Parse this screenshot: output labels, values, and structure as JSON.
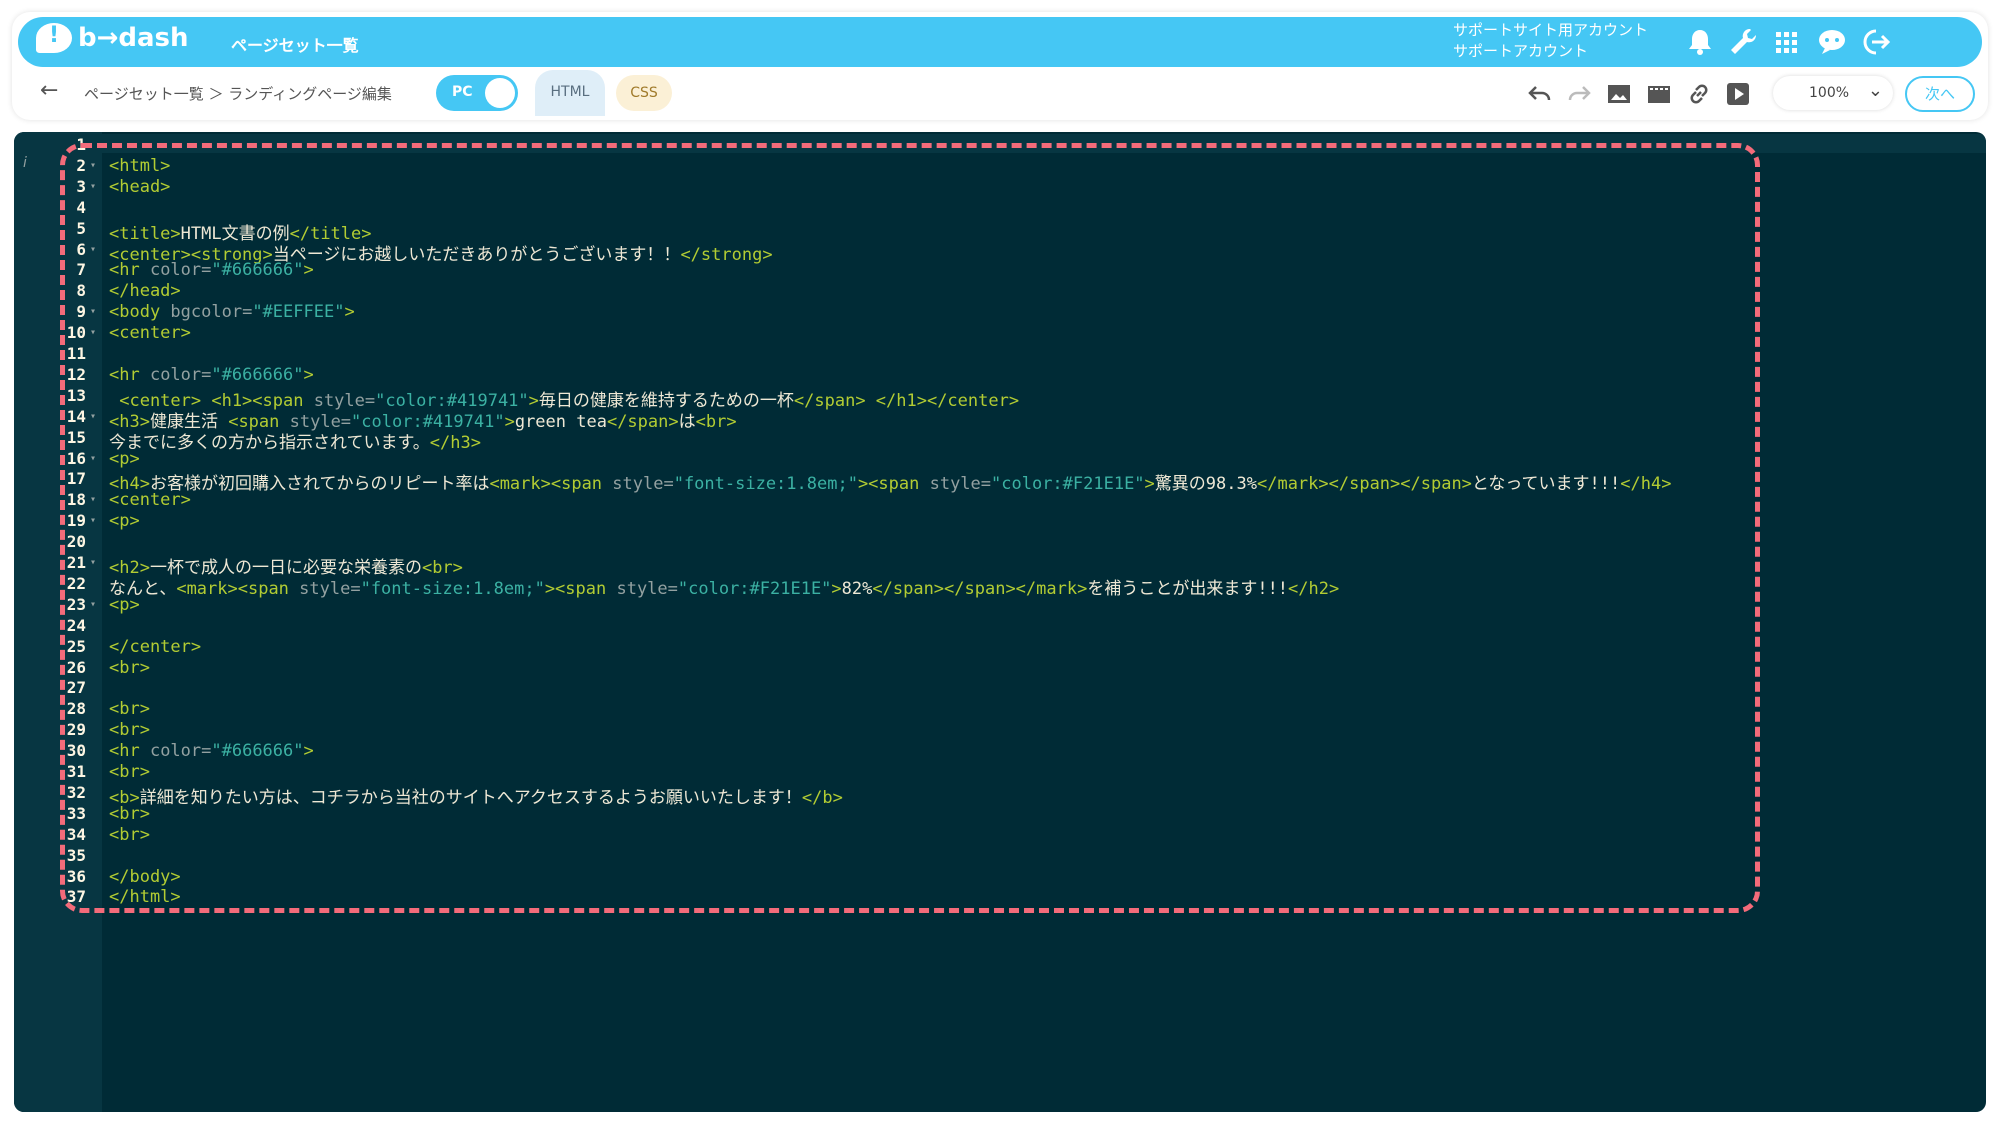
{
  "header": {
    "logo_text": "b→dash",
    "page_title": "ページセット一覧",
    "account_line1": "サポートサイト用アカウント",
    "account_line2": "サポートアカウント",
    "icons": [
      "bell-icon",
      "wrench-icon",
      "grid-icon",
      "chat-icon",
      "logout-icon"
    ]
  },
  "toolbar": {
    "back_icon": "←",
    "breadcrumb": "ページセット一覧 ＞ ランディングページ編集",
    "toggle_label": "PC",
    "tab_html": "HTML",
    "tab_css": "CSS",
    "tools": [
      "undo-icon",
      "redo-icon",
      "image-icon",
      "video-icon",
      "link-icon",
      "play-icon"
    ],
    "zoom": "100%",
    "next_label": "次へ"
  },
  "editor": {
    "info_marker": "i",
    "lines": [
      {
        "n": "1",
        "fold": false,
        "parts": []
      },
      {
        "n": "2",
        "fold": true,
        "parts": [
          [
            "tag",
            "<html>"
          ]
        ]
      },
      {
        "n": "3",
        "fold": true,
        "parts": [
          [
            "tag",
            "<head>"
          ]
        ]
      },
      {
        "n": "4",
        "fold": false,
        "parts": []
      },
      {
        "n": "5",
        "fold": false,
        "parts": [
          [
            "tag",
            "<title>"
          ],
          [
            "txt",
            "HTML文書の例"
          ],
          [
            "tag",
            "</title>"
          ]
        ]
      },
      {
        "n": "6",
        "fold": true,
        "parts": [
          [
            "tag",
            "<center><strong>"
          ],
          [
            "txt",
            "当ページにお越しいただきありがとうございます！！"
          ],
          [
            "tag",
            "</strong>"
          ]
        ]
      },
      {
        "n": "7",
        "fold": false,
        "parts": [
          [
            "tag",
            "<hr "
          ],
          [
            "attr",
            "color="
          ],
          [
            "val",
            "\"#666666\""
          ],
          [
            "tag",
            ">"
          ]
        ]
      },
      {
        "n": "8",
        "fold": false,
        "parts": [
          [
            "tag",
            "</head>"
          ]
        ]
      },
      {
        "n": "9",
        "fold": true,
        "parts": [
          [
            "tag",
            "<body "
          ],
          [
            "attr",
            "bgcolor="
          ],
          [
            "val",
            "\"#EEFFEE\""
          ],
          [
            "tag",
            ">"
          ]
        ]
      },
      {
        "n": "10",
        "fold": true,
        "parts": [
          [
            "tag",
            "<center>"
          ]
        ]
      },
      {
        "n": "11",
        "fold": false,
        "parts": []
      },
      {
        "n": "12",
        "fold": false,
        "parts": [
          [
            "tag",
            "<hr "
          ],
          [
            "attr",
            "color="
          ],
          [
            "val",
            "\"#666666\""
          ],
          [
            "tag",
            ">"
          ]
        ]
      },
      {
        "n": "13",
        "fold": false,
        "parts": [
          [
            "tag",
            " <center> <h1><span "
          ],
          [
            "attr",
            "style="
          ],
          [
            "val",
            "\"color:#419741\""
          ],
          [
            "tag",
            ">"
          ],
          [
            "txt",
            "毎日の健康を維持するための一杯"
          ],
          [
            "tag",
            "</span> </h1></center>"
          ]
        ]
      },
      {
        "n": "14",
        "fold": true,
        "parts": [
          [
            "tag",
            "<h3>"
          ],
          [
            "txt",
            "健康生活 "
          ],
          [
            "tag",
            "<span "
          ],
          [
            "attr",
            "style="
          ],
          [
            "val",
            "\"color:#419741\""
          ],
          [
            "tag",
            ">"
          ],
          [
            "txt",
            "green tea"
          ],
          [
            "tag",
            "</span>"
          ],
          [
            "txt",
            "は"
          ],
          [
            "tag",
            "<br>"
          ]
        ]
      },
      {
        "n": "15",
        "fold": false,
        "parts": [
          [
            "txt",
            "今までに多くの方から指示されています。"
          ],
          [
            "tag",
            "</h3>"
          ]
        ]
      },
      {
        "n": "16",
        "fold": true,
        "parts": [
          [
            "tag",
            "<p>"
          ]
        ]
      },
      {
        "n": "17",
        "fold": false,
        "parts": [
          [
            "tag",
            "<h4>"
          ],
          [
            "txt",
            "お客様が初回購入されてからのリピート率は"
          ],
          [
            "tag",
            "<mark><span "
          ],
          [
            "attr",
            "style="
          ],
          [
            "val",
            "\"font-size:1.8em;\""
          ],
          [
            "tag",
            "><span "
          ],
          [
            "attr",
            "style="
          ],
          [
            "val",
            "\"color:#F21E1E\""
          ],
          [
            "tag",
            ">"
          ],
          [
            "txt",
            "驚異の98.3%"
          ],
          [
            "tag",
            "</mark></span></span>"
          ],
          [
            "txt",
            "となっています!!!"
          ],
          [
            "tag",
            "</h4>"
          ]
        ]
      },
      {
        "n": "18",
        "fold": true,
        "parts": [
          [
            "tag",
            "<center>"
          ]
        ]
      },
      {
        "n": "19",
        "fold": true,
        "parts": [
          [
            "tag",
            "<p>"
          ]
        ]
      },
      {
        "n": "20",
        "fold": false,
        "parts": []
      },
      {
        "n": "21",
        "fold": true,
        "parts": [
          [
            "tag",
            "<h2>"
          ],
          [
            "txt",
            "一杯で成人の一日に必要な栄養素の"
          ],
          [
            "tag",
            "<br>"
          ]
        ]
      },
      {
        "n": "22",
        "fold": false,
        "parts": [
          [
            "txt",
            "なんと、"
          ],
          [
            "tag",
            "<mark><span "
          ],
          [
            "attr",
            "style="
          ],
          [
            "val",
            "\"font-size:1.8em;\""
          ],
          [
            "tag",
            "><span "
          ],
          [
            "attr",
            "style="
          ],
          [
            "val",
            "\"color:#F21E1E\""
          ],
          [
            "tag",
            ">"
          ],
          [
            "txt",
            "82%"
          ],
          [
            "tag",
            "</span></span></mark>"
          ],
          [
            "txt",
            "を補うことが出来ます!!!"
          ],
          [
            "tag",
            "</h2>"
          ]
        ]
      },
      {
        "n": "23",
        "fold": true,
        "parts": [
          [
            "tag",
            "<p>"
          ]
        ]
      },
      {
        "n": "24",
        "fold": false,
        "parts": []
      },
      {
        "n": "25",
        "fold": false,
        "parts": [
          [
            "tag",
            "</center>"
          ]
        ]
      },
      {
        "n": "26",
        "fold": false,
        "parts": [
          [
            "tag",
            "<br>"
          ]
        ]
      },
      {
        "n": "27",
        "fold": false,
        "parts": []
      },
      {
        "n": "28",
        "fold": false,
        "parts": [
          [
            "tag",
            "<br>"
          ]
        ]
      },
      {
        "n": "29",
        "fold": false,
        "parts": [
          [
            "tag",
            "<br>"
          ]
        ]
      },
      {
        "n": "30",
        "fold": false,
        "parts": [
          [
            "tag",
            "<hr "
          ],
          [
            "attr",
            "color="
          ],
          [
            "val",
            "\"#666666\""
          ],
          [
            "tag",
            ">"
          ]
        ]
      },
      {
        "n": "31",
        "fold": false,
        "parts": [
          [
            "tag",
            "<br>"
          ]
        ]
      },
      {
        "n": "32",
        "fold": false,
        "parts": [
          [
            "tag",
            "<b>"
          ],
          [
            "txt",
            "詳細を知りたい方は、コチラから当社のサイトへアクセスするようお願いいたします！"
          ],
          [
            "tag",
            "</b>"
          ]
        ]
      },
      {
        "n": "33",
        "fold": false,
        "parts": [
          [
            "tag",
            "<br>"
          ]
        ]
      },
      {
        "n": "34",
        "fold": false,
        "parts": [
          [
            "tag",
            "<br>"
          ]
        ]
      },
      {
        "n": "35",
        "fold": false,
        "parts": []
      },
      {
        "n": "36",
        "fold": false,
        "parts": [
          [
            "tag",
            "</body>"
          ]
        ]
      },
      {
        "n": "37",
        "fold": false,
        "parts": [
          [
            "tag",
            "</html>"
          ]
        ]
      }
    ]
  },
  "colors": {
    "brand": "#45c7f4",
    "editor_bg": "#002b36",
    "highlight_border": "#f36b7a"
  }
}
